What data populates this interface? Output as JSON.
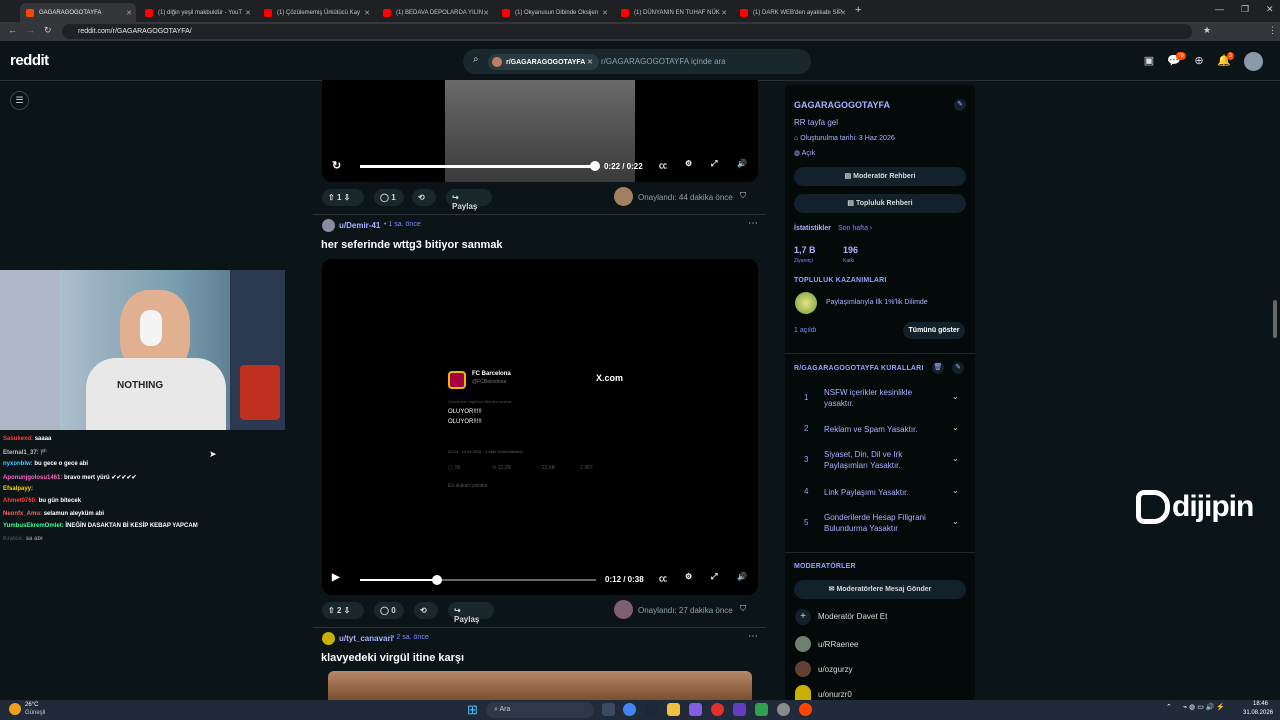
{
  "browser": {
    "tabs": [
      {
        "label": "GAGARAGOGOTAYFA",
        "color": "#ff4500"
      },
      {
        "label": "(1) diğin yeşil makbuldür - YouT",
        "color": "#ff0000"
      },
      {
        "label": "(1) Çözülememiş Ürkütücü Kay",
        "color": "#ff0000"
      },
      {
        "label": "(1) BEDAVA DEPOLARDA YILIN",
        "color": "#ff0000"
      },
      {
        "label": "(1) Okyanusun Dibinde Oksijen",
        "color": "#ff0000"
      },
      {
        "label": "(1) DÜNYANIN EN TUHAF NÜK",
        "color": "#ff0000"
      },
      {
        "label": "(1) DARK WEB'den ayakkabı SİP",
        "color": "#ff0000"
      }
    ],
    "new_tab": "+",
    "url": "reddit.com/r/GAGARAGOGOTAYFA/"
  },
  "header": {
    "logo": "reddit",
    "search_chip": "r/GAGARAGOGOTAYFA",
    "search_placeholder": "r/GAGARAGOGOTAYFA içinde ara",
    "chat_badge": "79",
    "notif_badge": "3"
  },
  "posts": [
    {
      "video": {
        "time": "0:22 / 0:22",
        "progress": 1.0
      },
      "votes": "1",
      "comments": "1",
      "share": "Paylaş",
      "approved": "Onaylandı: 44 dakika önce"
    },
    {
      "author": "u/Demir-41",
      "age": "1 sa. önce",
      "title": "her seferinde wttg3 bitiyor sanmak",
      "tweet": {
        "name": "FC Barcelona",
        "handle": "@FCBarcelona",
        "translate": "Gönderinin İngilizce dilinden çevirisi",
        "line1": "OLUYOR!!!!!",
        "line2": "OLUYOR!!!!!",
        "footer": "22:23 · 14.04.2026 · 1,6Mn Görüntülenme",
        "stats": [
          "96",
          "12,2B",
          "22,6B",
          "987"
        ],
        "replies": "En alakalı yanıtlar",
        "brand": "X.com"
      },
      "video": {
        "time": "0:12 / 0:38",
        "progress": 0.32
      },
      "votes": "2",
      "comments": "0",
      "share": "Paylaş",
      "approved": "Onaylandı: 27 dakika önce"
    },
    {
      "author": "u/tyt_canavari",
      "age": "2 sa. önce",
      "title": "klavyedeki virgül itine karşı"
    }
  ],
  "sidebar": {
    "name": "GAGARAGOGOTAYFA",
    "desc": "RR tayfa gel",
    "created": "Oluşturulma tarihi: 3 Haz 2026",
    "visibility": "Açık",
    "btn_mod_guide": "Moderatör Rehberi",
    "btn_community_guide": "Topluluk Rehberi",
    "stats_label": "İstatistikler",
    "stats_period": "Son hafta ›",
    "visitors": "1,7 B",
    "visitors_label": "Ziyaretçi",
    "contributions": "196",
    "contributions_label": "Katkı",
    "achievements_title": "TOPLULUK KAZANIMLARI",
    "achievement": "Paylaşımlarıyla İlk 1%'lik Dilimde",
    "unlocked": "1 açıldı",
    "show_all": "Tümünü göster",
    "rules_title": "R/GAGARAGOGOTAYFA KURALLARI",
    "rules": [
      {
        "n": "1",
        "t": "NSFW içerikler kesinlikle yasaktır."
      },
      {
        "n": "2",
        "t": "Reklam ve Spam Yasaktır."
      },
      {
        "n": "3",
        "t": "Siyaset, Din, Dil ve Irk Paylaşımları Yasaktır."
      },
      {
        "n": "4",
        "t": "Link Paylaşımı Yasaktır."
      },
      {
        "n": "5",
        "t": "Gonderilerde Hesap Filigrani Bulundurma Yasaktır"
      }
    ],
    "mods_title": "MODERATÖRLER",
    "msg_mods": "Moderatörlere Mesaj Gönder",
    "invite": "Moderatör Davet Et",
    "mods": [
      "u/RRaenee",
      "u/ozgurzy",
      "u/onurzr0"
    ]
  },
  "chat": [
    {
      "user": "Sasukexd:",
      "msg": "saaaa",
      "color": "#ff4040"
    },
    {
      "user": "Eternal1_37:",
      "msg": "🏴",
      "color": "#c0c0c0"
    },
    {
      "user": "nyxonblw:",
      "msg": "bu gece o gece abi",
      "color": "#46c8ff"
    },
    {
      "user": "Aponunjgolosu1461:",
      "msg": "bravo mert yürü ✔✔✔✔✔",
      "color": "#ff66cc"
    },
    {
      "user": "Efsalpayy:",
      "msg": "",
      "color": "#ffd700"
    },
    {
      "user": "Ahmet0760:",
      "msg": "bu gün bitecek",
      "color": "#ff4040"
    },
    {
      "user": "Neonfx_Amu:",
      "msg": "selamun aleyküm abi",
      "color": "#ff6060"
    },
    {
      "user": "YumbusEkremOmlet:",
      "msg": "İNEĞİN DASAKTAN Bİ KESİP KEBAP YAPCAM",
      "color": "#40ffa0"
    },
    {
      "user": "Kratos:",
      "msg": "sa abi",
      "color": "#6a8a6a"
    }
  ],
  "overlay_brand": "dijipin",
  "taskbar": {
    "weather_temp": "26°C",
    "weather_desc": "Güneşli",
    "search": "Ara",
    "time": "18:46",
    "date": "31.08.2026"
  }
}
